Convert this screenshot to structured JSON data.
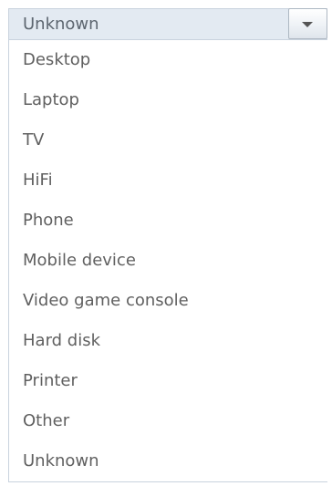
{
  "dropdown": {
    "selected": "Unknown",
    "arrow_icon": "chevron-down-icon",
    "options": [
      "Desktop",
      "Laptop",
      "TV",
      "HiFi",
      "Phone",
      "Mobile device",
      "Video game console",
      "Hard disk",
      "Printer",
      "Other",
      "Unknown"
    ]
  }
}
